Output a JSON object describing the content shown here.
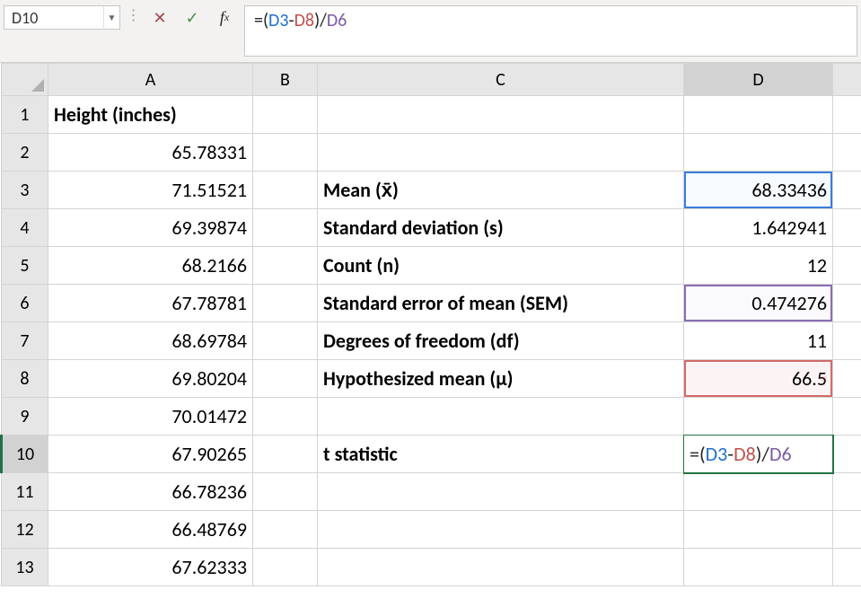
{
  "nameBox": "D10",
  "formulaBar": {
    "raw": "=(D3-D8)/D6",
    "tokens": [
      {
        "t": "=(",
        "c": "tok-eq"
      },
      {
        "t": "D3",
        "c": "tok-blue"
      },
      {
        "t": "-",
        "c": "tok-op"
      },
      {
        "t": "D8",
        "c": "tok-red"
      },
      {
        "t": ")/",
        "c": "tok-op"
      },
      {
        "t": "D6",
        "c": "tok-purple"
      }
    ]
  },
  "columns": [
    "A",
    "B",
    "C",
    "D"
  ],
  "rows": [
    "1",
    "2",
    "3",
    "4",
    "5",
    "6",
    "7",
    "8",
    "9",
    "10",
    "11",
    "12",
    "13"
  ],
  "activeRow": "10",
  "activeCol": "D",
  "cells": {
    "A1": "Height (inches)",
    "A2": "65.78331",
    "A3": "71.51521",
    "A4": "69.39874",
    "A5": "68.2166",
    "A6": "67.78781",
    "A7": "68.69784",
    "A8": "69.80204",
    "A9": "70.01472",
    "A10": "67.90265",
    "A11": "66.78236",
    "A12": "66.48769",
    "A13": "67.62333",
    "C3": "Mean (x̄)",
    "C4": "Standard deviation (s)",
    "C5": "Count (n)",
    "C6": "Standard error of mean (SEM)",
    "C7": "Degrees of freedom (df)",
    "C8": "Hypothesized mean (μ)",
    "C10": "t statistic",
    "D3": "68.33436",
    "D4": "1.642941",
    "D5": "12",
    "D6": "0.474276",
    "D7": "11",
    "D8": "66.5"
  },
  "editingCell": "D10"
}
